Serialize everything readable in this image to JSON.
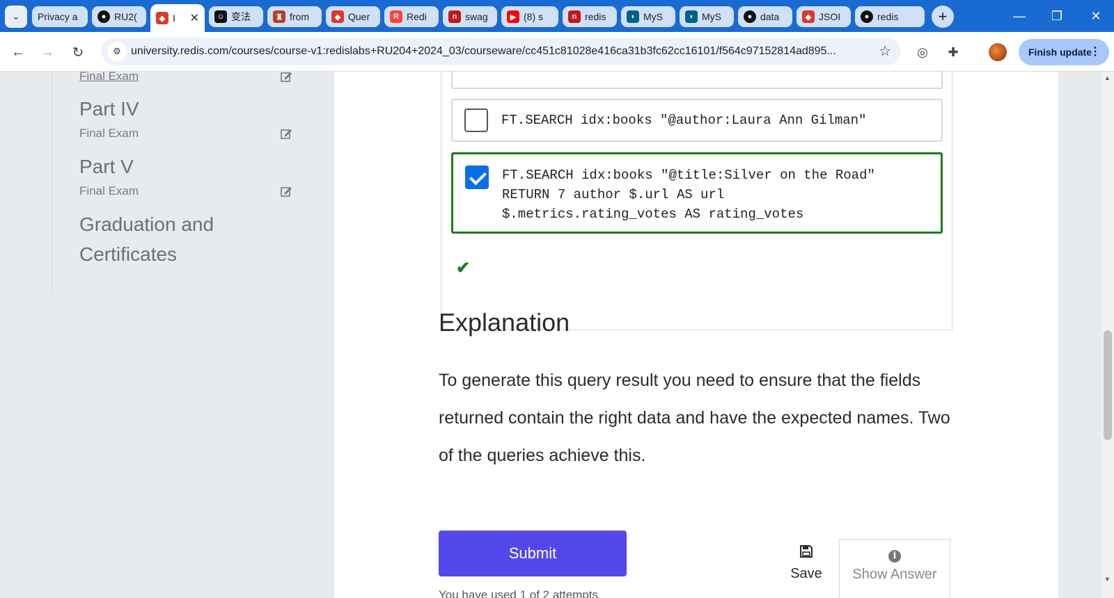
{
  "browser": {
    "tabs": [
      {
        "label": "Privacy a",
        "favicon": "privacy-icon",
        "color": "#cfe0f8"
      },
      {
        "label": "RU2(",
        "favicon": "github-icon",
        "color": "#111111"
      },
      {
        "label": "I",
        "favicon": "redis-cube-icon",
        "color": "#dc382d",
        "active": true
      },
      {
        "label": "变法",
        "favicon": "chatbot-icon",
        "color": "#111111"
      },
      {
        "label": "from",
        "favicon": "crest-icon",
        "color": "#c0392b"
      },
      {
        "label": "Quer",
        "favicon": "redis-cube-icon",
        "color": "#dc382d"
      },
      {
        "label": "Redi",
        "favicon": "redis-logo-icon",
        "color": "#ff4438"
      },
      {
        "label": "swag",
        "favicon": "n-icon",
        "color": "#c4161c"
      },
      {
        "label": "(8) s",
        "favicon": "youtube-icon",
        "color": "#ff0000"
      },
      {
        "label": "redis",
        "favicon": "n-icon",
        "color": "#c4161c"
      },
      {
        "label": "MyS",
        "favicon": "mysql-icon",
        "color": "#00618a"
      },
      {
        "label": "MyS",
        "favicon": "mysql-icon",
        "color": "#00618a"
      },
      {
        "label": "data",
        "favicon": "github-icon",
        "color": "#111111"
      },
      {
        "label": "JSOI",
        "favicon": "redis-cube-icon",
        "color": "#dc382d"
      },
      {
        "label": "redis",
        "favicon": "github-icon",
        "color": "#111111"
      }
    ],
    "close_glyph": "✕",
    "new_tab_glyph": "+",
    "url": "university.redis.com/courses/course-v1:redislabs+RU204+2024_03/courseware/cc451c81028e416ca31b3fc62cc16101/f564c97152814ad895...",
    "finish_update_label": "Finish update",
    "accent": "#1a6bd1"
  },
  "sidebar": {
    "items": [
      {
        "title": "",
        "subtitle": "Final Exam"
      },
      {
        "title": "Part IV",
        "subtitle": "Final Exam"
      },
      {
        "title": "Part V",
        "subtitle": "Final Exam"
      },
      {
        "title": "Graduation and\nCertificates",
        "subtitle": ""
      }
    ]
  },
  "question": {
    "options": [
      {
        "code": "FT.SEARCH idx:books \"@author:Laura Ann Gilman\"",
        "checked": false
      },
      {
        "code": "FT.SEARCH idx:books \"@title:Silver on the Road\"\nRETURN 7 author $.url AS url\n$.metrics.rating_votes AS rating_votes",
        "checked": true
      }
    ],
    "correct_color": "#1a7f1a"
  },
  "explanation": {
    "title": "Explanation",
    "body": "To generate this query result you need to ensure that the fields returned contain the right data and have the expected names. Two of the queries achieve this."
  },
  "actions": {
    "submit_label": "Submit",
    "save_label": "Save",
    "show_answer_label": "Show Answer",
    "attempts_text": "You have used 1 of 2 attempts",
    "submit_color": "#5448ea"
  }
}
